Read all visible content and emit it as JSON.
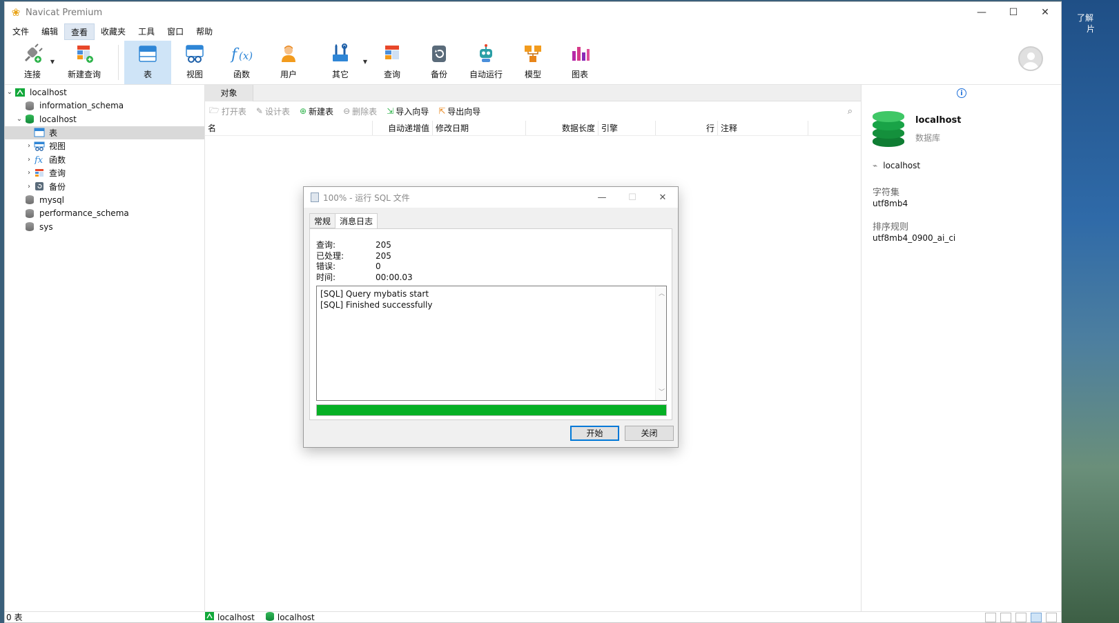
{
  "window": {
    "title": "Navicat Premium",
    "controls": {
      "minimize": "—",
      "maximize": "☐",
      "close": "✕"
    }
  },
  "menu": [
    "文件",
    "编辑",
    "查看",
    "收藏夹",
    "工具",
    "窗口",
    "帮助"
  ],
  "menu_active": "查看",
  "toolbar": [
    {
      "label": "连接",
      "icon": "plug-icon"
    },
    {
      "label": "新建查询",
      "icon": "new-query-icon"
    },
    {
      "label": "表",
      "icon": "table-icon"
    },
    {
      "label": "视图",
      "icon": "view-icon"
    },
    {
      "label": "函数",
      "icon": "function-icon"
    },
    {
      "label": "用户",
      "icon": "user-icon"
    },
    {
      "label": "其它",
      "icon": "tools-icon"
    },
    {
      "label": "查询",
      "icon": "query-icon"
    },
    {
      "label": "备份",
      "icon": "backup-icon"
    },
    {
      "label": "自动运行",
      "icon": "robot-icon"
    },
    {
      "label": "模型",
      "icon": "model-icon"
    },
    {
      "label": "图表",
      "icon": "chart-icon"
    }
  ],
  "tree": {
    "root": "localhost",
    "dbs": [
      "information_schema",
      "localhost",
      "mysql",
      "performance_schema",
      "sys"
    ],
    "children": [
      "表",
      "视图",
      "函数",
      "查询",
      "备份"
    ]
  },
  "objects": {
    "tab": "对象",
    "tools": [
      "打开表",
      "设计表",
      "新建表",
      "删除表",
      "导入向导",
      "导出向导"
    ],
    "columns": [
      "名",
      "自动递增值",
      "修改日期",
      "数据长度",
      "引擎",
      "行",
      "注释"
    ]
  },
  "info": {
    "name": "localhost",
    "type": "数据库",
    "host": "localhost",
    "charset_label": "字符集",
    "charset": "utf8mb4",
    "collation_label": "排序规则",
    "collation": "utf8mb4_0900_ai_ci"
  },
  "status": {
    "left": "0 表",
    "conn1": "localhost",
    "conn2": "localhost"
  },
  "dialog": {
    "title": "100% - 运行 SQL 文件",
    "tabs": [
      "常规",
      "消息日志"
    ],
    "stats": [
      {
        "k": "查询:",
        "v": "205"
      },
      {
        "k": "已处理:",
        "v": "205"
      },
      {
        "k": "错误:",
        "v": "0"
      },
      {
        "k": "时间:",
        "v": "00:00.03"
      }
    ],
    "log": [
      "[SQL] Query mybatis start",
      "[SQL] Finished successfully"
    ],
    "progress": 1.0,
    "start": "开始",
    "close": "关闭"
  },
  "desktop_text": [
    "了解",
    "片"
  ],
  "colors": {
    "accent": "#0078d7",
    "progress": "#06b025",
    "db_green": "#12893a",
    "selected": "#cfe4f7"
  }
}
